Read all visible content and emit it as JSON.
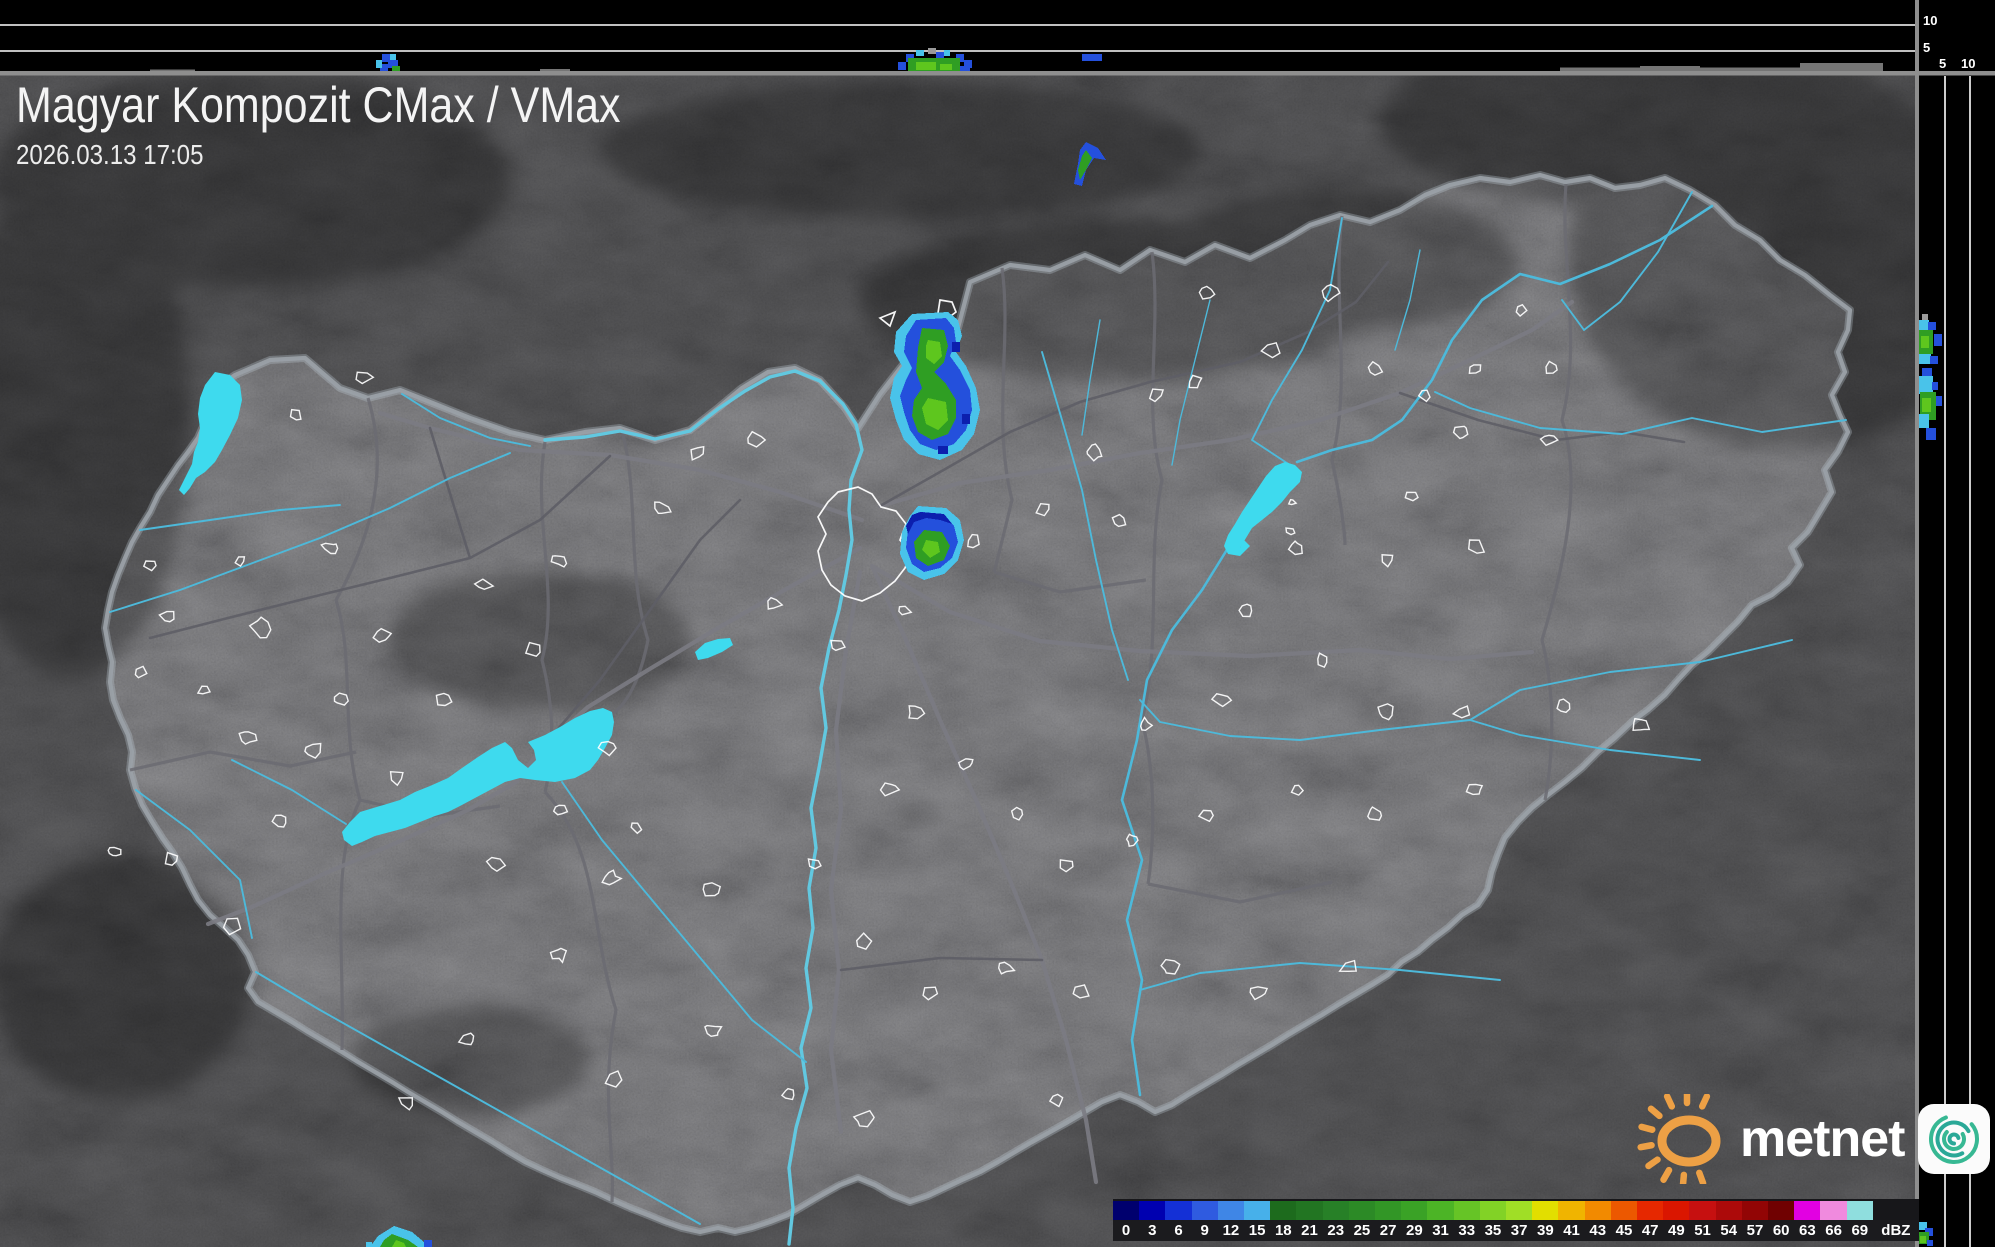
{
  "header": {
    "title": "Magyar Kompozit CMax / VMax",
    "timestamp": "2026.03.13 17:05"
  },
  "profile_axes": {
    "top_upper_km": "10",
    "top_lower_km": "5",
    "right_near_km": "5",
    "right_far_km": "10"
  },
  "legend": {
    "unit_label": "dBZ",
    "stops": [
      {
        "label": "0",
        "color": "#00006e"
      },
      {
        "label": "3",
        "color": "#0000b0"
      },
      {
        "label": "6",
        "color": "#1430d6"
      },
      {
        "label": "9",
        "color": "#2f5be0"
      },
      {
        "label": "12",
        "color": "#3f86e6"
      },
      {
        "label": "15",
        "color": "#47b0ea"
      },
      {
        "label": "18",
        "color": "#1d6b1d"
      },
      {
        "label": "21",
        "color": "#227522"
      },
      {
        "label": "23",
        "color": "#278027"
      },
      {
        "label": "25",
        "color": "#2c8a26"
      },
      {
        "label": "27",
        "color": "#329626"
      },
      {
        "label": "29",
        "color": "#3aa226"
      },
      {
        "label": "31",
        "color": "#4cb426"
      },
      {
        "label": "33",
        "color": "#66c426"
      },
      {
        "label": "35",
        "color": "#82d226"
      },
      {
        "label": "37",
        "color": "#a0de26"
      },
      {
        "label": "39",
        "color": "#e2de00"
      },
      {
        "label": "41",
        "color": "#f0b400"
      },
      {
        "label": "43",
        "color": "#f28a00"
      },
      {
        "label": "45",
        "color": "#ec5800"
      },
      {
        "label": "47",
        "color": "#e62800"
      },
      {
        "label": "49",
        "color": "#da1600"
      },
      {
        "label": "51",
        "color": "#c61010"
      },
      {
        "label": "54",
        "color": "#ac0a0a"
      },
      {
        "label": "57",
        "color": "#920505"
      },
      {
        "label": "60",
        "color": "#700101"
      },
      {
        "label": "63",
        "color": "#e200e2"
      },
      {
        "label": "66",
        "color": "#f08ade"
      },
      {
        "label": "69",
        "color": "#8fdede"
      }
    ]
  },
  "branding": {
    "wordmark": "metnet",
    "sun_color": "#eda045",
    "spiral_color": "#37b893"
  },
  "map_colors": {
    "water": "#3edaee",
    "river": "#4db9da",
    "country_border": "#9aa0a6",
    "county_border": "#6b6b72",
    "settlement_outline": "#ffffff"
  }
}
